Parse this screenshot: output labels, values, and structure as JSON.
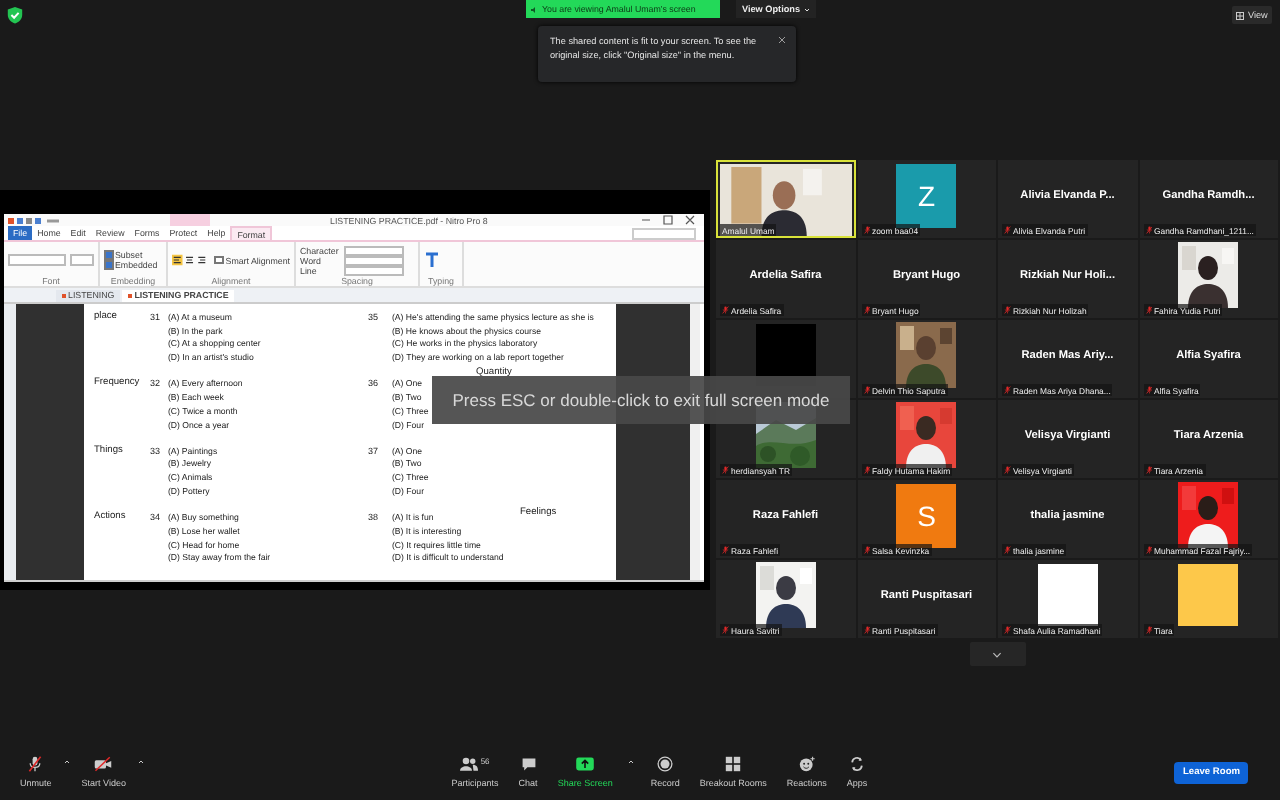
{
  "top_bar": {
    "banner": "You are viewing Amalul Umam's screen",
    "view_options": "View Options",
    "tooltip": "The shared content is fit to your screen. To see the original size, click \"Original size\" in the menu.",
    "view_button": "View"
  },
  "shared_screen": {
    "window_title": "LISTENING PRACTICE.pdf - Nitro Pro 8",
    "ribbon_tabs": [
      {
        "label": "File",
        "kind": "file",
        "selected": false
      },
      {
        "label": "Home",
        "kind": "tab",
        "selected": false
      },
      {
        "label": "Edit",
        "kind": "tab",
        "selected": false
      },
      {
        "label": "Review",
        "kind": "tab",
        "selected": false
      },
      {
        "label": "Forms",
        "kind": "tab",
        "selected": false
      },
      {
        "label": "Protect",
        "kind": "tab",
        "selected": false
      },
      {
        "label": "Help",
        "kind": "tab",
        "selected": false
      },
      {
        "label": "Format",
        "kind": "tab",
        "selected": true
      }
    ],
    "embedding_options": [
      {
        "label": "Subset",
        "checked": true
      },
      {
        "label": "Embedded",
        "checked": true
      }
    ],
    "smart_alignment": {
      "label": "Smart Alignment",
      "checked": false
    },
    "spacing_fields": [
      "Character",
      "Word",
      "Line"
    ],
    "group_labels": [
      "Font",
      "Embedding",
      "Alignment",
      "Spacing",
      "Typing"
    ],
    "doc_tabs": [
      {
        "label": "LISTENING",
        "selected": false
      },
      {
        "label": "LISTENING PRACTICE",
        "selected": true
      }
    ],
    "overlay": "Press ESC or double-click to exit full screen mode",
    "questions_left": [
      {
        "category": "place",
        "number": "31",
        "options": [
          "(A) At a museum",
          "(B) In the park",
          "(C) At a shopping center",
          "(D) In an artist's studio"
        ]
      },
      {
        "category": "Frequency",
        "number": "32",
        "options": [
          "(A) Every afternoon",
          "(B) Each week",
          "(C) Twice a month",
          "(D) Once a year"
        ]
      },
      {
        "category": "Things",
        "number": "33",
        "options": [
          "(A) Paintings",
          "(B) Jewelry",
          "(C) Animals",
          "(D) Pottery"
        ]
      },
      {
        "category": "Actions",
        "number": "34",
        "options": [
          "(A) Buy something",
          "(B) Lose her wallet",
          "(C) Head for home",
          "(D) Stay away from the fair"
        ]
      }
    ],
    "questions_right": [
      {
        "number": "35",
        "options": [
          "(A) He's attending the same physics lecture as she is",
          "(B) He knows about the physics course",
          "(C) He works in the physics laboratory",
          "(D) They are working on a lab report together"
        ]
      },
      {
        "number": "36",
        "note": "Quantity",
        "options": [
          "(A) One",
          "(B) Two",
          "(C) Three",
          "(D) Four"
        ]
      },
      {
        "number": "37",
        "options": [
          "(A) One",
          "(B) Two",
          "(C) Three",
          "(D) Four"
        ]
      },
      {
        "number": "38",
        "note": "Feelings",
        "options": [
          "(A) It is fun",
          "(B) It is interesting",
          "(C) It requires little time",
          "(D) It is difficult to understand"
        ]
      }
    ]
  },
  "gallery": {
    "tiles": [
      {
        "label": "Amalul Umam",
        "muted": false,
        "speaking": true
      },
      {
        "kind": "letter",
        "letter": "Z",
        "color": "#1a9bab",
        "label": "zoom baa04",
        "muted": true,
        "speaking": false
      },
      {
        "kind": "name",
        "name": "Alivia Elvanda P...",
        "label": "Alivia Elvanda Putri",
        "muted": true,
        "speaking": false
      },
      {
        "kind": "name",
        "name": "Gandha Ramdh...",
        "label": "Gandha Ramdhani_1211...",
        "muted": true,
        "speaking": false
      },
      {
        "kind": "name",
        "name": "Ardelia Safira",
        "label": "Ardelia Safira",
        "muted": true,
        "speaking": false
      },
      {
        "kind": "name",
        "name": "Bryant Hugo",
        "label": "Bryant Hugo",
        "muted": true,
        "speaking": false
      },
      {
        "kind": "name",
        "name": "Rizkiah Nur Holi...",
        "label": "Rizkiah Nur Holizah",
        "muted": true,
        "speaking": false
      },
      {
        "label": "Fahira Yudia Putri",
        "muted": true,
        "speaking": false
      },
      {
        "kind": "block",
        "color": "#000000",
        "speaking": false
      },
      {
        "label": "Delvin Thio Saputra",
        "muted": true,
        "speaking": false
      },
      {
        "kind": "name",
        "name": "Raden Mas Ariy...",
        "label": "Raden Mas Ariya Dhana...",
        "muted": true,
        "speaking": false
      },
      {
        "kind": "name",
        "name": "Alfia Syafira",
        "label": "Alfia Syafira",
        "muted": true,
        "speaking": false
      },
      {
        "label": "herdiansyah TR",
        "muted": true,
        "speaking": false
      },
      {
        "label": "Faldy Hutama Hakim",
        "muted": true,
        "speaking": false
      },
      {
        "kind": "name",
        "name": "Velisya Virgianti",
        "label": "Velisya Virgianti",
        "muted": true,
        "speaking": false
      },
      {
        "kind": "name",
        "name": "Tiara Arzenia",
        "label": "Tiara Arzenia",
        "muted": true,
        "speaking": false
      },
      {
        "kind": "name",
        "name": "Raza Fahlefi",
        "label": "Raza Fahlefi",
        "muted": true,
        "speaking": false
      },
      {
        "kind": "letter",
        "letter": "S",
        "color": "#f07a10",
        "label": "Salsa Kevinzka",
        "muted": true,
        "speaking": false
      },
      {
        "kind": "name",
        "name": "thalia jasmine",
        "label": "thalia jasmine",
        "muted": true,
        "speaking": false
      },
      {
        "label": "Muhammad Fazal Fajriy...",
        "muted": true,
        "speaking": false
      },
      {
        "label": "Haura Savitri",
        "muted": true,
        "speaking": false
      },
      {
        "kind": "name",
        "name": "Ranti Puspitasari",
        "label": "Ranti Puspitasari",
        "muted": true,
        "speaking": false
      },
      {
        "kind": "block",
        "color": "#ffffff",
        "label": "Shafa Aulia Ramadhani",
        "muted": true,
        "speaking": false
      },
      {
        "kind": "block",
        "color": "#fdc84a",
        "label": "Tiara",
        "muted": true,
        "speaking": false
      }
    ]
  },
  "toolbar": {
    "left": [
      {
        "kind": "mic",
        "label": "Unmute",
        "caret": true
      },
      {
        "kind": "video",
        "label": "Start Video",
        "caret": true
      }
    ],
    "center": [
      {
        "kind": "participants",
        "label": "Participants",
        "count": "56",
        "caret": false
      },
      {
        "kind": "chat",
        "label": "Chat",
        "caret": false
      },
      {
        "kind": "share",
        "label": "Share Screen",
        "caret": true
      },
      {
        "kind": "record",
        "label": "Record",
        "caret": false
      },
      {
        "kind": "breakout",
        "label": "Breakout Rooms",
        "caret": false
      },
      {
        "kind": "reactions",
        "label": "Reactions",
        "caret": false
      },
      {
        "kind": "apps",
        "label": "Apps",
        "caret": false
      }
    ],
    "leave": "Leave Room"
  }
}
